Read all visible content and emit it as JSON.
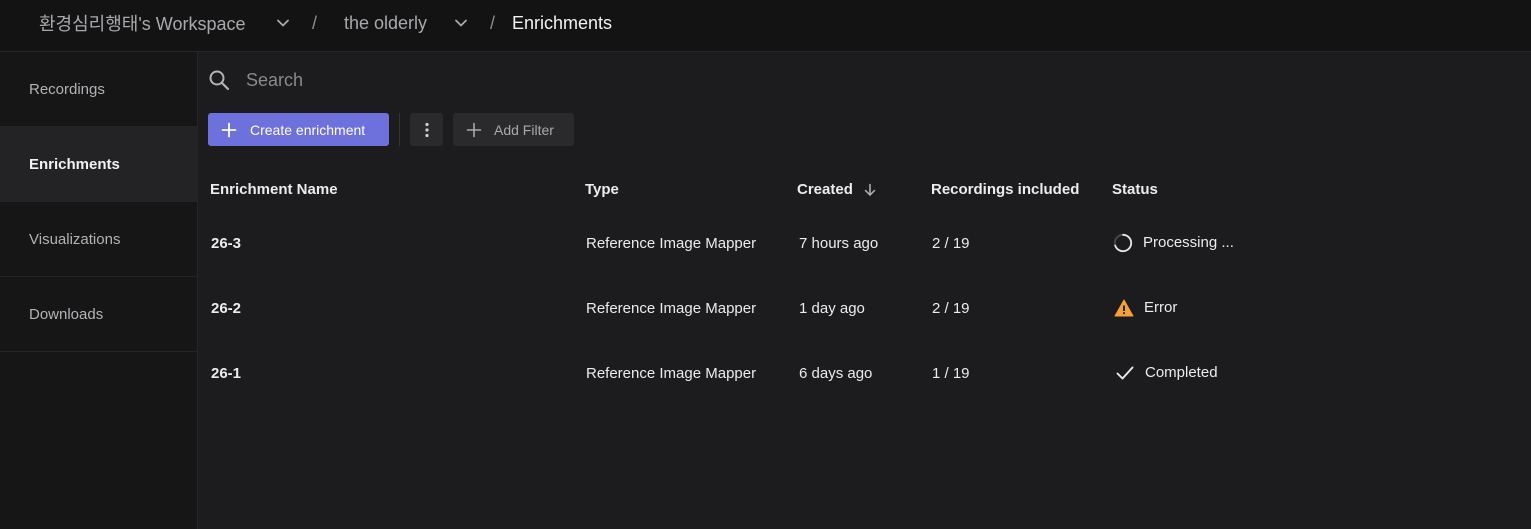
{
  "breadcrumb": {
    "workspace": "환경심리행태's Workspace",
    "project": "the olderly",
    "current": "Enrichments",
    "separator": "/"
  },
  "sidebar": {
    "items": [
      {
        "label": "Recordings",
        "active": false
      },
      {
        "label": "Enrichments",
        "active": true
      },
      {
        "label": "Visualizations",
        "active": false
      },
      {
        "label": "Downloads",
        "active": false
      }
    ]
  },
  "search": {
    "placeholder": "Search",
    "value": ""
  },
  "toolbar": {
    "create_label": "Create enrichment",
    "add_filter_label": "Add Filter"
  },
  "table": {
    "headers": {
      "name": "Enrichment Name",
      "type": "Type",
      "created": "Created",
      "recordings": "Recordings included",
      "status": "Status"
    },
    "rows": [
      {
        "name": "26-3",
        "type": "Reference Image Mapper",
        "created": "7 hours ago",
        "recordings": "2 / 19",
        "status": "Processing ...",
        "status_icon": "spinner-icon"
      },
      {
        "name": "26-2",
        "type": "Reference Image Mapper",
        "created": "1 day ago",
        "recordings": "2 / 19",
        "status": "Error",
        "status_icon": "warning-icon"
      },
      {
        "name": "26-1",
        "type": "Reference Image Mapper",
        "created": "6 days ago",
        "recordings": "1 / 19",
        "status": "Completed",
        "status_icon": "check-icon"
      }
    ]
  },
  "colors": {
    "accent": "#6e70db",
    "warning": "#f2a23a",
    "background": "#1c1c1e",
    "sidebar": "#161617",
    "topbar": "#131314"
  }
}
